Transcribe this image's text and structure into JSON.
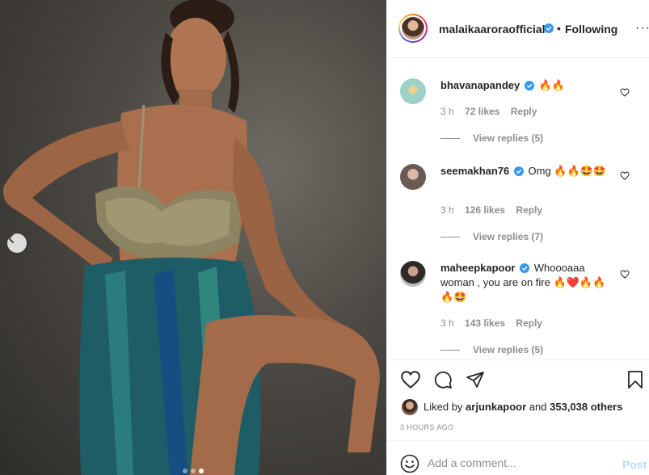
{
  "post": {
    "carousel": {
      "total": 3,
      "active_index": 2
    }
  },
  "header": {
    "username": "malaikaaroraofficial",
    "separator": "•",
    "follow_status": "Following",
    "more": "···"
  },
  "comments": [
    {
      "user": "bhavanapandey",
      "text": "🔥🔥",
      "time": "3 h",
      "likes": "72 likes",
      "reply": "Reply",
      "view_replies": "View replies (5)"
    },
    {
      "user": "seemakhan76",
      "text": "Omg 🔥🔥🤩🤩",
      "time": "3 h",
      "likes": "126 likes",
      "reply": "Reply",
      "view_replies": "View replies (7)"
    },
    {
      "user": "maheepkapoor",
      "text": "Whoooaaa woman , you are on fire 🔥❤️🔥🔥🔥🤩",
      "time": "3 h",
      "likes": "143 likes",
      "reply": "Reply",
      "view_replies": "View replies (5)"
    }
  ],
  "liked_by": {
    "prefix": "Liked by",
    "user": "arjunkapoor",
    "joiner": "and",
    "others": "353,038 others"
  },
  "timestamp": "3 HOURS AGO",
  "add_comment": {
    "placeholder": "Add a comment...",
    "post_label": "Post"
  },
  "colors": {
    "text": "#262626",
    "secondary": "#8e8e8e",
    "verified": "#3897f0",
    "post_disabled": "#b2dffc"
  }
}
